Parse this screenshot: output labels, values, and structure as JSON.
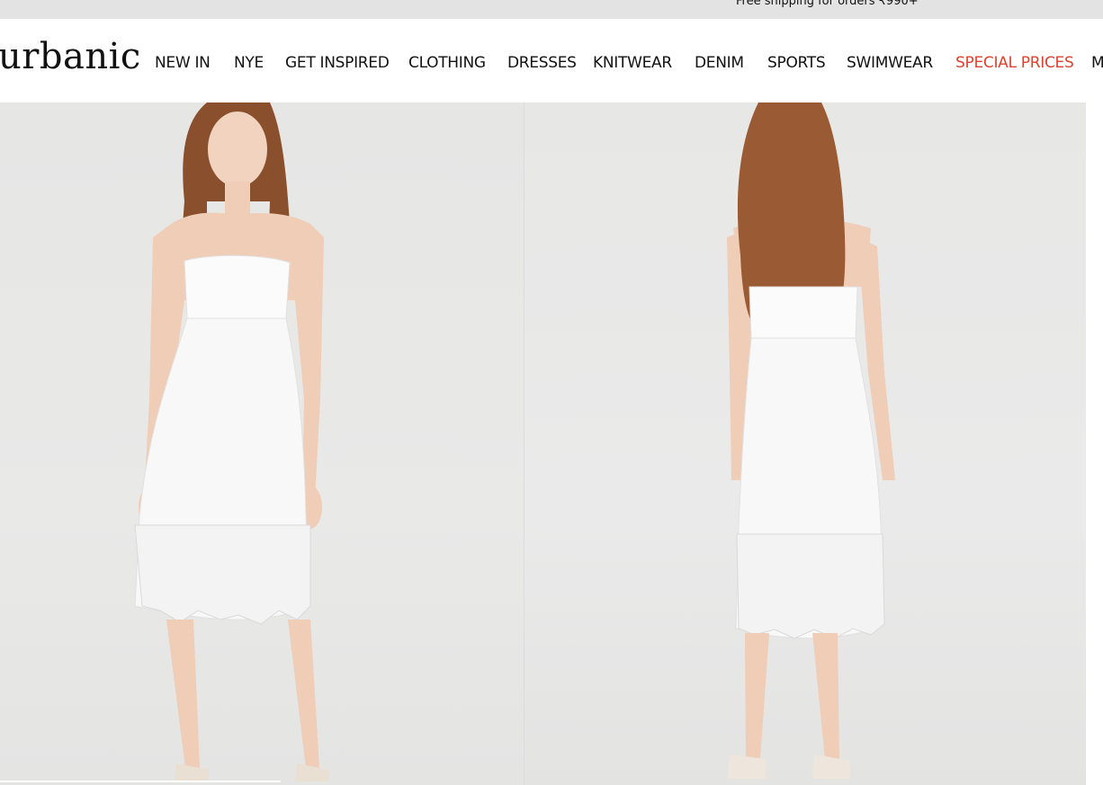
{
  "promo": {
    "text": "Free shipping for orders ₹990+"
  },
  "brand": {
    "logo_text": "urbanic"
  },
  "nav": {
    "items": [
      {
        "label": "NEW IN",
        "special": false
      },
      {
        "label": "NYE",
        "special": false
      },
      {
        "label": "GET INSPIRED",
        "special": false
      },
      {
        "label": "CLOTHING",
        "special": false
      },
      {
        "label": "DRESSES",
        "special": false
      },
      {
        "label": "KNITWEAR",
        "special": false
      },
      {
        "label": "DENIM",
        "special": false
      },
      {
        "label": "SPORTS",
        "special": false
      },
      {
        "label": "SWIMWEAR",
        "special": false
      },
      {
        "label": "SPECIAL PRICES",
        "special": true
      },
      {
        "label": "M",
        "special": false
      }
    ]
  },
  "colors": {
    "special_price": "#e0412e",
    "promo_bg": "#e3e3e3",
    "photo_bg": "#e8e8e7"
  },
  "gallery": {
    "images": [
      {
        "view": "front"
      },
      {
        "view": "back"
      }
    ]
  }
}
